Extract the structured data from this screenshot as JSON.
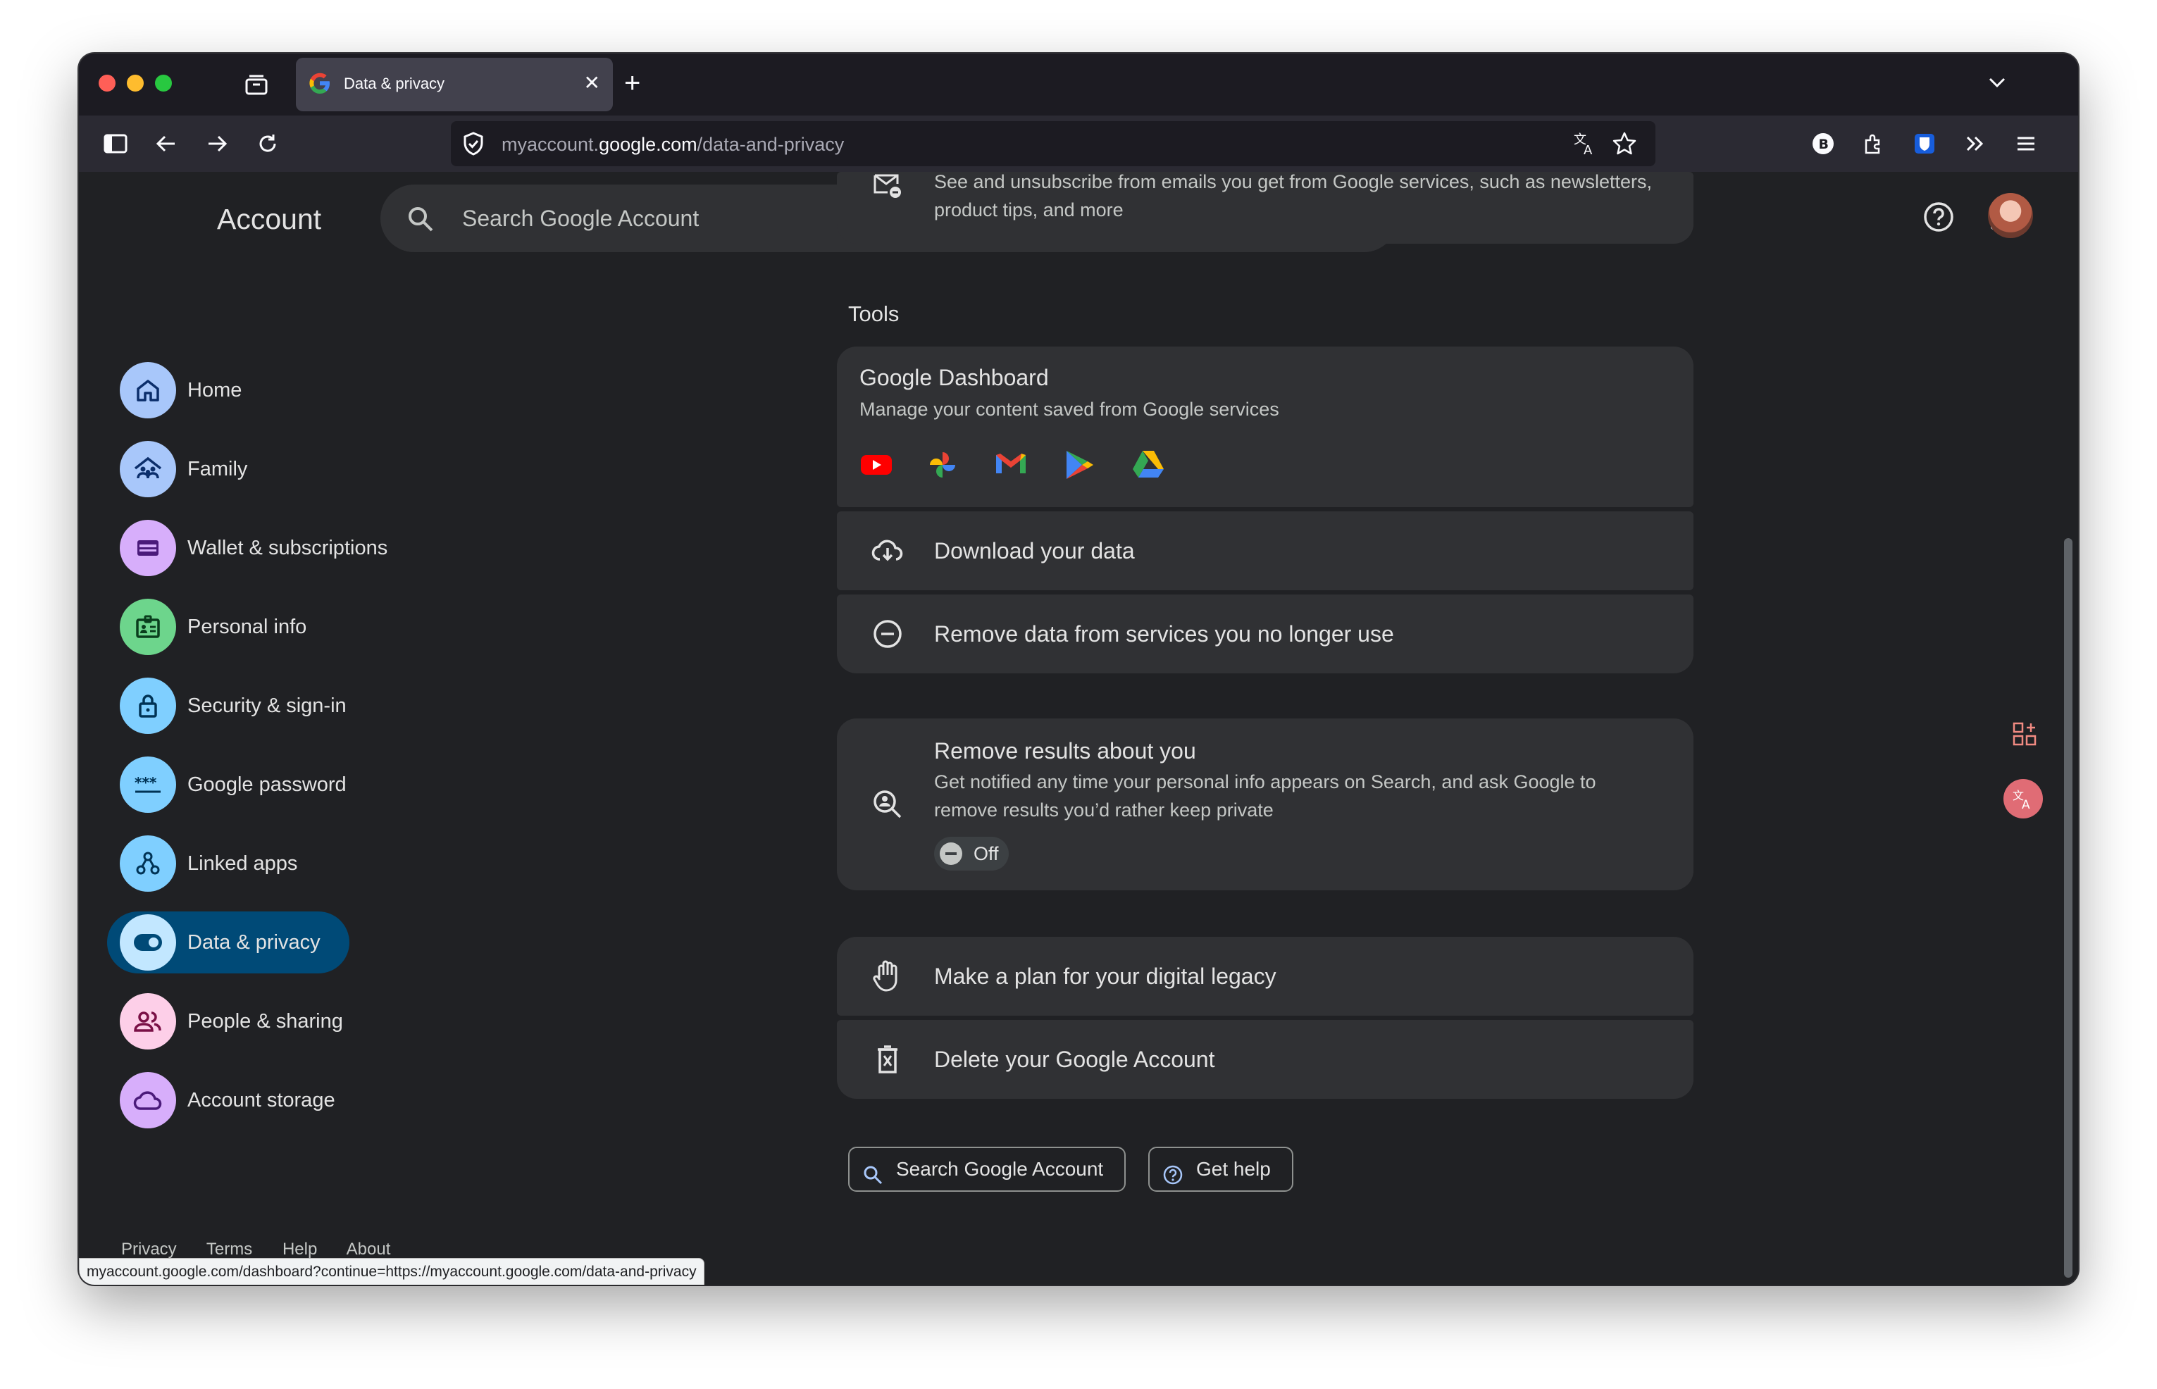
{
  "browser": {
    "tab_title": "Data & privacy",
    "url_domain_prefix": "myaccount.",
    "url_domain": "google.com",
    "url_path": "/data-and-privacy",
    "status_url": "myaccount.google.com/dashboard?continue=https://myaccount.google.com/data-and-privacy"
  },
  "header": {
    "brand": "Account",
    "search_placeholder": "Search Google Account"
  },
  "sidebar": {
    "items": [
      {
        "label": "Home",
        "color": "#a8c7fa",
        "icon": "home-icon"
      },
      {
        "label": "Family",
        "color": "#a8c7fa",
        "icon": "family-icon"
      },
      {
        "label": "Wallet & subscriptions",
        "color": "#d7aefb",
        "icon": "wallet-icon"
      },
      {
        "label": "Personal info",
        "color": "#6dd58c",
        "icon": "id-card-icon"
      },
      {
        "label": "Security & sign-in",
        "color": "#7fcfff",
        "icon": "lock-icon"
      },
      {
        "label": "Google password",
        "color": "#7fcfff",
        "icon": "password-icon"
      },
      {
        "label": "Linked apps",
        "color": "#7fcfff",
        "icon": "linked-apps-icon"
      },
      {
        "label": "Data & privacy",
        "color": "#c2e7ff",
        "icon": "toggle-icon"
      },
      {
        "label": "People & sharing",
        "color": "#fdcfe8",
        "icon": "people-icon"
      },
      {
        "label": "Account storage",
        "color": "#d7aefb",
        "icon": "cloud-icon"
      }
    ],
    "footer": [
      "Privacy",
      "Terms",
      "Help",
      "About"
    ]
  },
  "main": {
    "email_subs_desc": "See and unsubscribe from emails you get from Google services, such as newsletters, product tips, and more",
    "tools_title": "Tools",
    "dashboard_title": "Google Dashboard",
    "dashboard_desc": "Manage your content saved from Google services",
    "download_label": "Download your data",
    "remove_services_label": "Remove data from services you no longer use",
    "remove_results_title": "Remove results about you",
    "remove_results_desc": "Get notified any time your personal info appears on Search, and ask Google to remove results you’d rather keep private",
    "remove_results_status": "Off",
    "legacy_label": "Make a plan for your digital legacy",
    "delete_label": "Delete your Google Account",
    "search_button": "Search Google Account",
    "help_button": "Get help"
  },
  "colors": {
    "page_bg": "#202124",
    "card_bg": "#303134",
    "active_nav": "#004a77"
  }
}
